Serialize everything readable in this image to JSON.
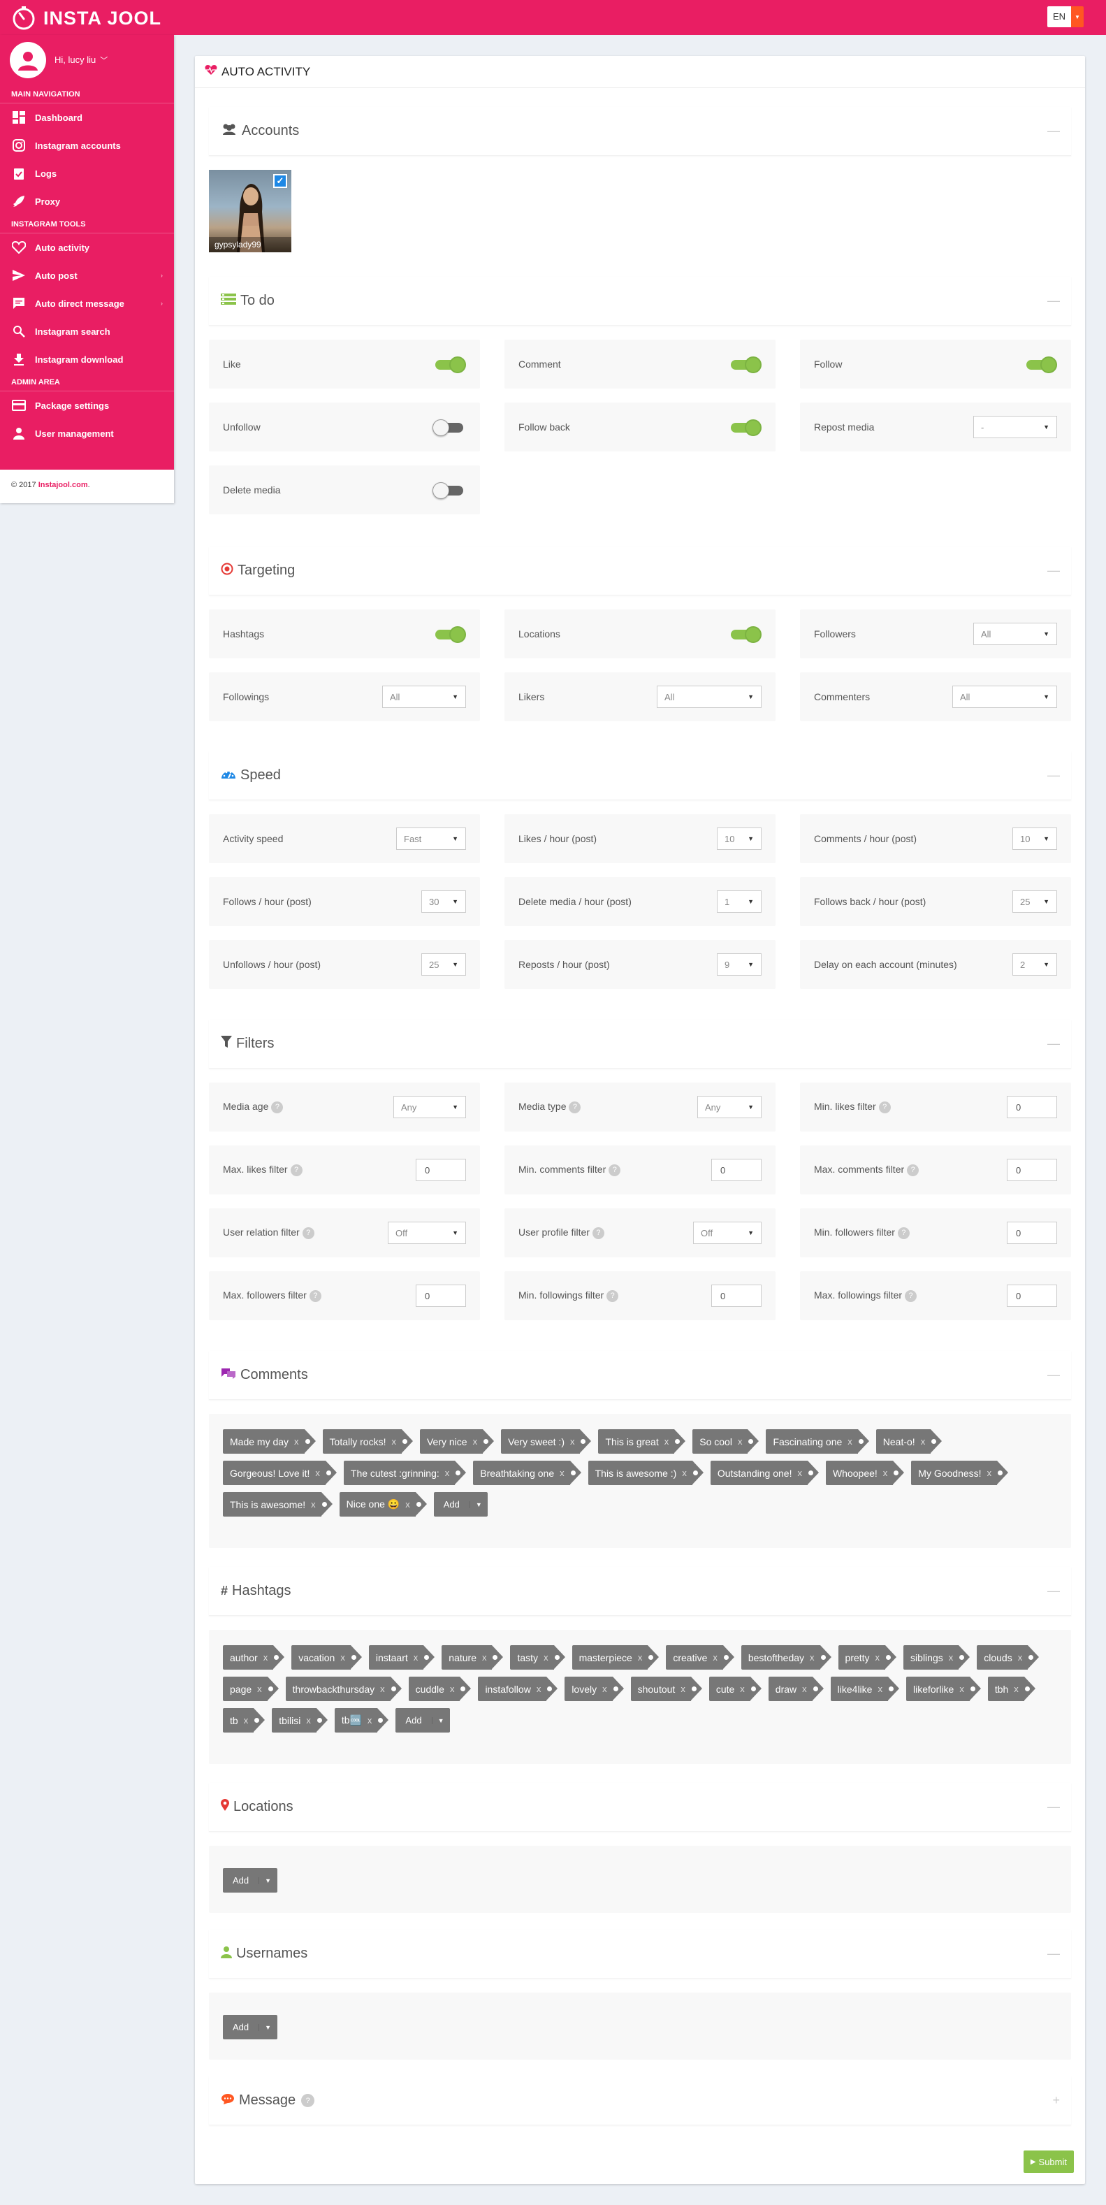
{
  "brand": {
    "name": "INSTA JOOL"
  },
  "lang": {
    "code": "EN"
  },
  "user": {
    "greeting": "Hi, lucy liu"
  },
  "nav": {
    "main_label": "MAIN NAVIGATION",
    "main": [
      {
        "label": "Dashboard",
        "icon": "dashboard-icon"
      },
      {
        "label": "Instagram accounts",
        "icon": "instagram-icon"
      },
      {
        "label": "Logs",
        "icon": "clipboard-check-icon"
      },
      {
        "label": "Proxy",
        "icon": "rocket-icon"
      }
    ],
    "tools_label": "INSTAGRAM TOOLS",
    "tools": [
      {
        "label": "Auto activity",
        "icon": "heart-icon"
      },
      {
        "label": "Auto post",
        "icon": "send-icon"
      },
      {
        "label": "Auto direct message",
        "icon": "message-icon"
      },
      {
        "label": "Instagram search",
        "icon": "search-icon"
      },
      {
        "label": "Instagram download",
        "icon": "download-icon"
      }
    ],
    "admin_label": "ADMIN AREA",
    "admin": [
      {
        "label": "Package settings",
        "icon": "credit-card-icon"
      },
      {
        "label": "User management",
        "icon": "person-icon"
      }
    ]
  },
  "footer": {
    "copyright": "© 2017 ",
    "link": "Instajool.com",
    "dot": "."
  },
  "page": {
    "title": "AUTO ACTIVITY"
  },
  "accounts": {
    "title": "Accounts",
    "username": "gypsylady99",
    "selected": true
  },
  "todo": {
    "title": "To do",
    "items": [
      {
        "label": "Like",
        "state": "on"
      },
      {
        "label": "Comment",
        "state": "on"
      },
      {
        "label": "Follow",
        "state": "on"
      },
      {
        "label": "Unfollow",
        "state": "off"
      },
      {
        "label": "Follow back",
        "state": "on"
      },
      {
        "label": "Repost media",
        "select": "-"
      },
      {
        "label": "Delete media",
        "state": "off"
      }
    ]
  },
  "targeting": {
    "title": "Targeting",
    "items": [
      {
        "label": "Hashtags",
        "state": "on"
      },
      {
        "label": "Locations",
        "state": "on"
      },
      {
        "label": "Followers",
        "select": "All"
      },
      {
        "label": "Followings",
        "select": "All"
      },
      {
        "label": "Likers",
        "select": "All"
      },
      {
        "label": "Commenters",
        "select": "All"
      }
    ]
  },
  "speed": {
    "title": "Speed",
    "items": [
      {
        "label": "Activity speed",
        "select": "Fast"
      },
      {
        "label": "Likes / hour (post)",
        "select": "10"
      },
      {
        "label": "Comments / hour (post)",
        "select": "10"
      },
      {
        "label": "Follows / hour (post)",
        "select": "30"
      },
      {
        "label": "Delete media / hour (post)",
        "select": "1"
      },
      {
        "label": "Follows back / hour (post)",
        "select": "25"
      },
      {
        "label": "Unfollows / hour (post)",
        "select": "25"
      },
      {
        "label": "Reposts / hour (post)",
        "select": "9"
      },
      {
        "label": "Delay on each account (minutes)",
        "select": "2"
      }
    ]
  },
  "filters": {
    "title": "Filters",
    "help": "?",
    "items": [
      {
        "label": "Media age",
        "select": "Any"
      },
      {
        "label": "Media type",
        "select": "Any"
      },
      {
        "label": "Min. likes filter",
        "input": "0"
      },
      {
        "label": "Max. likes filter",
        "input": "0"
      },
      {
        "label": "Min. comments filter",
        "input": "0"
      },
      {
        "label": "Max. comments filter",
        "input": "0"
      },
      {
        "label": "User relation filter",
        "select": "Off"
      },
      {
        "label": "User profile filter",
        "select": "Off"
      },
      {
        "label": "Min. followers filter",
        "input": "0"
      },
      {
        "label": "Max. followers filter",
        "input": "0"
      },
      {
        "label": "Min. followings filter",
        "input": "0"
      },
      {
        "label": "Max. followings filter",
        "input": "0"
      }
    ]
  },
  "comments": {
    "title": "Comments",
    "tags": [
      "Made my day",
      "Totally rocks!",
      "Very nice",
      "Very sweet :)",
      "This is great",
      "So cool",
      "Fascinating one",
      "Neat-o!",
      "Gorgeous! Love it!",
      "The cutest :grinning:",
      "Breathtaking one",
      "This is awesome :)",
      "Outstanding one!",
      "Whoopee!",
      "My Goodness!",
      "This is awesome!",
      "Nice one 😀"
    ]
  },
  "hashtags": {
    "title": "Hashtags",
    "tags": [
      "author",
      "vacation",
      "instaart",
      "nature",
      "tasty",
      "masterpiece",
      "creative",
      "bestoftheday",
      "pretty",
      "siblings",
      "clouds",
      "page",
      "throwbackthursday",
      "cuddle",
      "instafollow",
      "lovely",
      "shoutout",
      "cute",
      "draw",
      "like4like",
      "likeforlike",
      "tbh",
      "tb",
      "tbilisi",
      "tb🆒"
    ]
  },
  "locations": {
    "title": "Locations"
  },
  "usernames": {
    "title": "Usernames"
  },
  "message": {
    "title": "Message",
    "help": "?"
  },
  "buttons": {
    "add": "Add",
    "submit": "Submit",
    "remove": "x"
  },
  "colors": {
    "brand": "#e91e63",
    "toggle_on": "#8bc34a",
    "submit": "#8bc34a",
    "tag": "#777777"
  }
}
